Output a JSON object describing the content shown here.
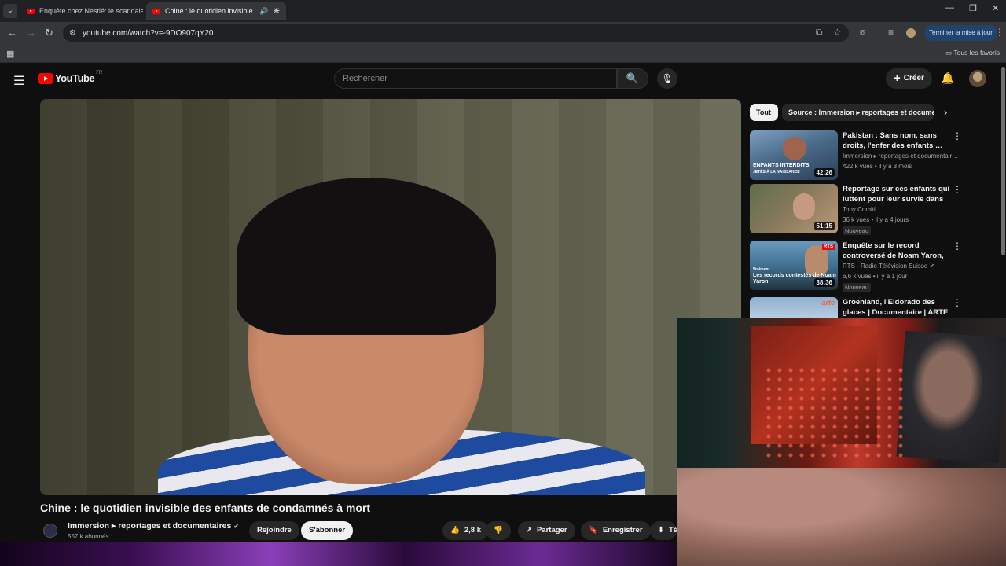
{
  "browser": {
    "tabs": [
      {
        "title": "Enquête chez Nestlé: le scandale",
        "active": false
      },
      {
        "title": "Chine : le quotidien invisible",
        "active": true
      }
    ],
    "url": "youtube.com/watch?v=-9DO907qY20",
    "update_button": "Terminer la mise à jour",
    "bookmarks_label": "Tous les favoris"
  },
  "youtube": {
    "logo": "YouTube",
    "region": "FR",
    "search_placeholder": "Rechercher",
    "create_label": "Créer"
  },
  "video": {
    "title": "Chine : le quotidien invisible des enfants de condamnés à mort",
    "channel": "Immersion ▸ reportages et documentaires",
    "subscribers": "557 k abonnés",
    "join_label": "Rejoindre",
    "subscribe_label": "S'abonner",
    "likes": "2,8 k",
    "share_label": "Partager",
    "save_label": "Enregistrer",
    "download_label": "Té"
  },
  "sidebar": {
    "chips": [
      "Tout",
      "Source : Immersion ▸ reportages et documentaires"
    ],
    "recommendations": [
      {
        "title": "Pakistan : Sans nom, sans droits, l'enfer des enfants …",
        "channel": "Immersion ▸ reportages et documentair…",
        "meta": "422 k vues • il y a 3 mois",
        "duration": "42:26",
        "badge": "",
        "thumb_text": "ENFANTS INTERDITS",
        "thumb_sub": "JETÉS À LA NAISSANCE",
        "thumb_color": "#4a6a8a"
      },
      {
        "title": "Reportage sur ces enfants qui luttent pour leur survie dans le…",
        "channel": "Tony Comiti",
        "meta": "36 k vues • il y a 4 jours",
        "duration": "51:15",
        "badge": "Nouveau",
        "thumb_text": "",
        "thumb_sub": "",
        "thumb_color": "#7a6a52"
      },
      {
        "title": "Enquête sur le record controversé de Noam Yaron, …",
        "channel": "RTS - Radio Télévision Suisse",
        "meta": "6,6 k vues • il y a 1 jour",
        "duration": "38:36",
        "badge": "Nouveau",
        "thumb_text": "Les records contestés de Noam Yaron",
        "thumb_sub": "Vraiment",
        "thumb_color": "#3d6c8c"
      },
      {
        "title": "Groenland, l'Eldorado des glaces | Documentaire | ARTE",
        "channel": "",
        "meta": "",
        "duration": "",
        "badge": "",
        "thumb_text": "",
        "thumb_sub": "",
        "thumb_color": "#8fb0d0"
      }
    ]
  }
}
